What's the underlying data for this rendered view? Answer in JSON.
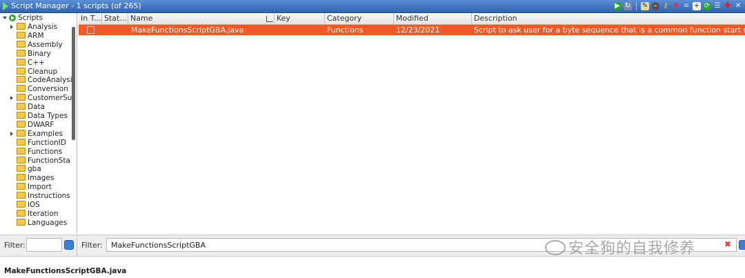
{
  "window": {
    "title": "Script Manager - 1 scripts  (of 265)"
  },
  "toolbar_icons": [
    "run-icon",
    "rerun-icon",
    "edit-icon",
    "delete-icon",
    "key-icon",
    "close-icon",
    "script-dirs-icon",
    "new-script-icon",
    "refresh-icon",
    "list-icon",
    "add-icon",
    "close-window-icon"
  ],
  "tree": {
    "root": "Scripts",
    "items": [
      {
        "label": "Analysis",
        "expandable": true
      },
      {
        "label": "ARM",
        "expandable": false
      },
      {
        "label": "Assembly",
        "expandable": false
      },
      {
        "label": "Binary",
        "expandable": false
      },
      {
        "label": "C++",
        "expandable": false
      },
      {
        "label": "Cleanup",
        "expandable": false
      },
      {
        "label": "CodeAnalysi",
        "expandable": false
      },
      {
        "label": "Conversion",
        "expandable": false
      },
      {
        "label": "CustomerSu",
        "expandable": true
      },
      {
        "label": "Data",
        "expandable": false
      },
      {
        "label": "Data Types",
        "expandable": false
      },
      {
        "label": "DWARF",
        "expandable": false
      },
      {
        "label": "Examples",
        "expandable": true
      },
      {
        "label": "FunctionID",
        "expandable": false
      },
      {
        "label": "Functions",
        "expandable": false
      },
      {
        "label": "FunctionSta",
        "expandable": false
      },
      {
        "label": "gba",
        "expandable": false
      },
      {
        "label": "Images",
        "expandable": false
      },
      {
        "label": "Import",
        "expandable": false
      },
      {
        "label": "Instructions",
        "expandable": false
      },
      {
        "label": "iOS",
        "expandable": false
      },
      {
        "label": "Iteration",
        "expandable": false
      },
      {
        "label": "Languages",
        "expandable": false
      }
    ]
  },
  "table": {
    "columns": [
      "In T...",
      "Stat...",
      "Name",
      "Key",
      "Category",
      "Modified",
      "Description"
    ],
    "rows": [
      {
        "in_toolbar": "",
        "status": "",
        "name": "MakeFunctionsScriptGBA.java",
        "key": "",
        "category": "Functions",
        "modified": "12/23/2021",
        "description": "Script to ask user for a byte sequence that is a common function start make fu..."
      }
    ]
  },
  "left_filter": {
    "label": "Filter:",
    "value": ""
  },
  "main_filter": {
    "label": "Filter:",
    "value": "MakeFunctionsScriptGBA"
  },
  "watermark": "安全狗的自我修养",
  "status": {
    "text": "MakeFunctionsScriptGBA.java"
  },
  "colors": {
    "selection": "#f05a28",
    "titlebar": "#3a6fc0",
    "folder": "#f6c94a"
  }
}
